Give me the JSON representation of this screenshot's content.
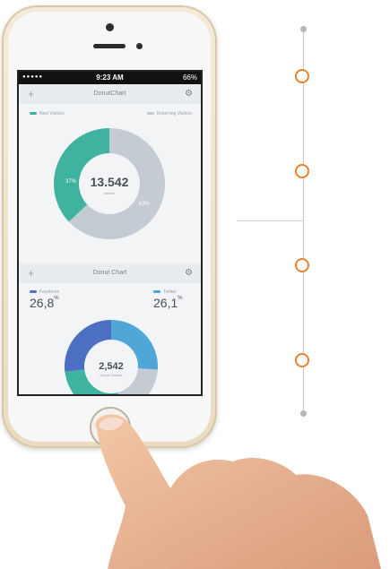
{
  "status_bar": {
    "time": "9:23 AM",
    "battery": "66%"
  },
  "card1": {
    "title": "DonutChart",
    "legend": [
      "New Visitors",
      "Returning Visitors"
    ],
    "center_value": "13.542",
    "center_label": "visitors",
    "slice_labels": [
      "37%",
      "63%"
    ]
  },
  "card2": {
    "title": "Donut Chart",
    "left_label": "Facebook",
    "left_value": "26,8",
    "right_label": "Twitter",
    "right_value": "26,1",
    "unit": "%",
    "center_value": "2,542",
    "center_label": "Social Visitors"
  },
  "chart_data": [
    {
      "type": "pie",
      "categories": [
        "New Visitors",
        "Returning Visitors"
      ],
      "values": [
        37,
        63
      ]
    },
    {
      "type": "pie",
      "categories": [
        "Facebook",
        "Twitter"
      ],
      "values": [
        26.8,
        26.1
      ]
    }
  ],
  "colors": {
    "teal": "#3fb3a0",
    "gray": "#c5cbd3",
    "blue": "#4fa7d8",
    "indigo": "#4c6fc4",
    "orange": "#e8812b"
  },
  "timeline": {
    "nodes": 4
  }
}
